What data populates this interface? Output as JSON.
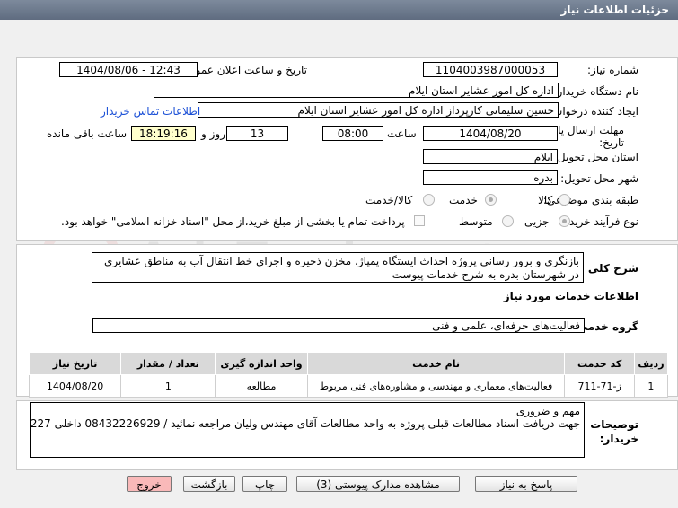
{
  "window": {
    "title": "جزئیات اطلاعات نیاز"
  },
  "watermark": {
    "text": "AriaTender.net"
  },
  "fields": {
    "need_number_label": "شماره نیاز:",
    "need_number": "1104003987000053",
    "announce_label": "تاریخ و ساعت اعلان عمومی:",
    "announce_value": "1404/08/06 - 12:43",
    "buyer_org_label": "نام دستگاه خریدار:",
    "buyer_org": "اداره کل امور عشایر استان ایلام",
    "creator_label": "ایجاد کننده درخواست:",
    "creator": "حسین سلیمانی کارپرداز اداره کل امور عشایر استان ایلام",
    "contact_link": "اطلاعات تماس خریدار",
    "deadline_label_1": "مهلت ارسال پاسخ: تا",
    "deadline_label_2": "تاریخ:",
    "deadline_date": "1404/08/20",
    "time_label": "ساعت",
    "deadline_time": "08:00",
    "days_value": "13",
    "days_label": "روز و",
    "remaining_time": "18:19:16",
    "remaining_label": "ساعت باقی مانده",
    "province_label": "استان محل تحویل:",
    "province": "ایلام",
    "city_label": "شهر محل تحویل:",
    "city": "بدره",
    "category_label": "طبقه بندی موضوعی:",
    "category_options": [
      "کالا",
      "خدمت",
      "کالا/خدمت"
    ],
    "process_label": "نوع فرآیند خرید :",
    "process_options": [
      "جزیی",
      "متوسط"
    ],
    "payment_text": "پرداخت تمام یا بخشی از مبلغ خرید،از محل \"اسناد خزانه اسلامی\" خواهد بود."
  },
  "summary": {
    "label": "شرح کلی نیاز:",
    "text": "بازنگری و برور رسانی پروژه احداث ایستگاه پمپاژ، مخزن ذخیره و اجرای خط انتقال آب به مناطق عشایری در شهرستان بدره به شرح خدمات پیوست"
  },
  "services": {
    "heading": "اطلاعات خدمات مورد نیاز",
    "group_label": "گروه خدمت:",
    "group_value": "فعالیت‌های حرفه‌ای، علمی و فنی",
    "columns": [
      "ردیف",
      "کد خدمت",
      "نام خدمت",
      "واحد اندازه گیری",
      "تعداد / مقدار",
      "تاریخ نیاز"
    ],
    "rows": [
      [
        "1",
        "ز-71-711",
        "فعالیت‌های معماری و مهندسی و مشاوره‌های فنی مربوط",
        "مطالعه",
        "1",
        "1404/08/20"
      ]
    ]
  },
  "buyer_notes": {
    "label_1": "توضیحات",
    "label_2": "خریدار:",
    "line1": "مهم و ضروری",
    "line2": "جهت دریافت اسناد مطالعات قبلی پروژه به واحد مطالعات آقای مهندس ولیان مراجعه نمائید / 08432226929 داخلی 227"
  },
  "buttons": {
    "reply": "پاسخ به نیاز",
    "attachments": "مشاهده مدارک پیوستی (3)",
    "print": "چاپ",
    "back": "بازگشت",
    "exit": "خروج"
  },
  "colors": {
    "titlebar": "#6e7b8f",
    "exit_button": "#f9b9b9",
    "link": "#1a4fd6",
    "remaining_box": "#ffffcc"
  }
}
